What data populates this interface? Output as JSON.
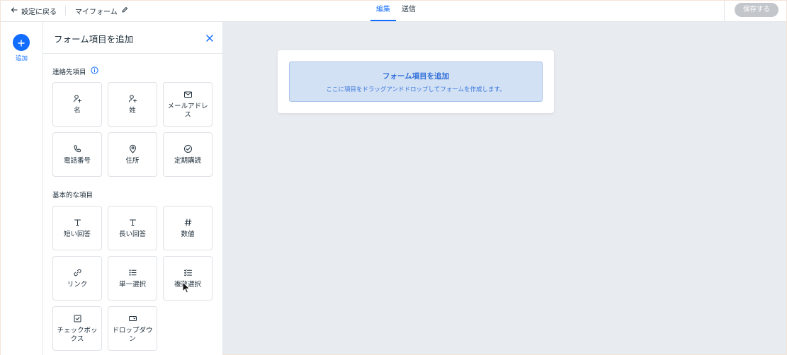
{
  "topbar": {
    "back_label": "設定に戻る",
    "form_name": "マイフォーム",
    "tabs": [
      {
        "label": "編集",
        "active": true
      },
      {
        "label": "送信",
        "active": false
      }
    ],
    "save_label": "保存する"
  },
  "rail": {
    "add_label": "追加"
  },
  "panel": {
    "title": "フォーム項目を追加",
    "sections": [
      {
        "title": "連絡先項目",
        "items": [
          {
            "label": "名",
            "icon": "person-plus-icon"
          },
          {
            "label": "姓",
            "icon": "person-plus-icon"
          },
          {
            "label": "メールアドレス",
            "icon": "mail-icon"
          },
          {
            "label": "電話番号",
            "icon": "phone-icon"
          },
          {
            "label": "住所",
            "icon": "location-pin-icon"
          },
          {
            "label": "定期購読",
            "icon": "check-circle-icon"
          }
        ]
      },
      {
        "title": "基本的な項目",
        "items": [
          {
            "label": "短い回答",
            "icon": "text-t-icon"
          },
          {
            "label": "長い回答",
            "icon": "text-t-icon"
          },
          {
            "label": "数値",
            "icon": "hash-icon"
          },
          {
            "label": "リンク",
            "icon": "link-icon"
          },
          {
            "label": "単一選択",
            "icon": "bullet-list-icon"
          },
          {
            "label": "複数選択",
            "icon": "checklist-icon"
          },
          {
            "label": "チェックボックス",
            "icon": "checkbox-icon"
          },
          {
            "label": "ドロップダウン",
            "icon": "dropdown-icon"
          }
        ]
      }
    ]
  },
  "canvas": {
    "drop_title": "フォーム項目を追加",
    "drop_description": "ここに項目をドラッグアンドドロップしてフォームを作成します。"
  },
  "colors": {
    "accent": "#116dff",
    "drop_zone_bg": "#d3e1f5",
    "canvas_bg": "#e8ebf0",
    "save_disabled": "#c3c7cc"
  }
}
